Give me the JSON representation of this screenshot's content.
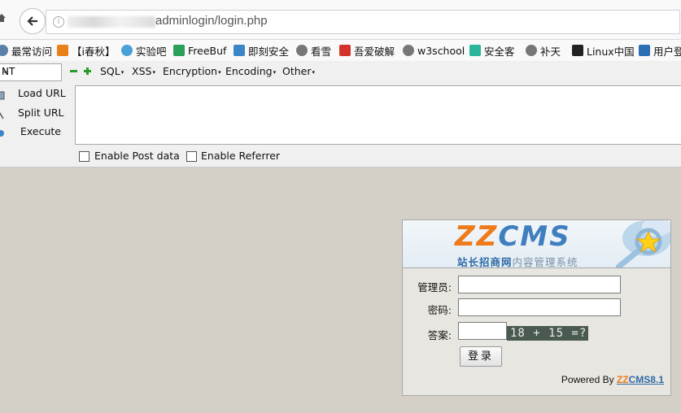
{
  "browser": {
    "url": "adminlogin/login.php",
    "bookmarks": [
      {
        "label": "最常访问",
        "icon": "gear-icon",
        "color": "#5a7fa8"
      },
      {
        "label": "【i春秋】",
        "icon": "ichunqiu-icon",
        "color": "#e8811a"
      },
      {
        "label": "实验吧",
        "icon": "shiyanba-icon",
        "color": "#4aa0d8"
      },
      {
        "label": "FreeBuf",
        "icon": "freebuf-icon",
        "color": "#2aa05a"
      },
      {
        "label": "即刻安全",
        "icon": "jike-icon",
        "color": "#3a86c8"
      },
      {
        "label": "看雪",
        "icon": "globe-icon",
        "color": "#777777"
      },
      {
        "label": "吾爱破解",
        "icon": "52pojie-icon",
        "color": "#d2332b"
      },
      {
        "label": "w3school",
        "icon": "globe-icon",
        "color": "#777777"
      },
      {
        "label": "安全客",
        "icon": "anquanke-icon",
        "color": "#2bb59a"
      },
      {
        "label": "补天",
        "icon": "globe-icon",
        "color": "#777777"
      },
      {
        "label": "Linux中国",
        "icon": "linux-icon",
        "color": "#222222"
      },
      {
        "label": "用户登",
        "icon": "user-login-icon",
        "color": "#2a6fb5"
      }
    ]
  },
  "hackbar": {
    "select_value": "NT",
    "menus": [
      "SQL",
      "XSS",
      "Encryption",
      "Encoding",
      "Other"
    ],
    "actions": [
      "Load URL",
      "Split URL",
      "Execute"
    ],
    "textarea_value": "",
    "checkboxes": [
      "Enable Post data",
      "Enable Referrer"
    ]
  },
  "login": {
    "logo_zz": "ZZ",
    "logo_cms": "CMS",
    "tagline_main": "站长招商网",
    "tagline_sub": "内容管理系统",
    "admin_label": "管理员:",
    "password_label": "密码:",
    "answer_label": "答案:",
    "captcha_text": "18 + 15 =?",
    "submit_label": "登录",
    "powered_prefix": "Powered By ",
    "powered_zz": "ZZ",
    "powered_cms": "CMS8.1"
  },
  "colors": {
    "page_bg": "#d4d0c8",
    "brand_orange": "#ee7a1a",
    "brand_blue": "#2f6aa7"
  }
}
